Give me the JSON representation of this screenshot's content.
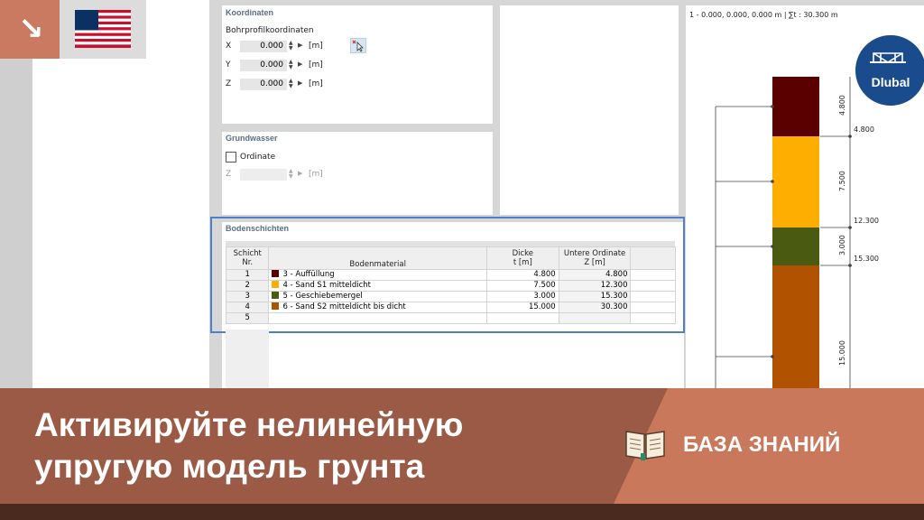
{
  "corner_arrow": "↘",
  "coords": {
    "title": "Koordinaten",
    "subtitle": "Bohrprofilkoordinaten",
    "rows": [
      {
        "label": "X",
        "value": "0.000",
        "unit": "[m]"
      },
      {
        "label": "Y",
        "value": "0.000",
        "unit": "[m]"
      },
      {
        "label": "Z",
        "value": "0.000",
        "unit": "[m]"
      }
    ]
  },
  "groundwater": {
    "title": "Grundwasser",
    "checkbox_label": "Ordinate",
    "z_label": "Z",
    "z_unit": "[m]"
  },
  "layers": {
    "title": "Bodenschichten",
    "headers": {
      "nr_line1": "Schicht",
      "nr_line2": "Nr.",
      "material": "Bodenmaterial",
      "thick_line1": "Dicke",
      "thick_line2": "t [m]",
      "ord_line1": "Untere Ordinate",
      "ord_line2": "Z [m]"
    },
    "rows": [
      {
        "nr": "1",
        "material": "3 - Auffüllung",
        "color": "#5a0000",
        "thickness": "4.800",
        "ordinate": "4.800"
      },
      {
        "nr": "2",
        "material": "4 - Sand S1 mitteldicht",
        "color": "#fdae00",
        "thickness": "7.500",
        "ordinate": "12.300"
      },
      {
        "nr": "3",
        "material": "5 - Geschiebemergel",
        "color": "#4a5a10",
        "thickness": "3.000",
        "ordinate": "15.300"
      },
      {
        "nr": "4",
        "material": "6 - Sand S2 mitteldicht bis dicht",
        "color": "#b05200",
        "thickness": "15.000",
        "ordinate": "30.300"
      },
      {
        "nr": "5",
        "material": "",
        "color": "",
        "thickness": "",
        "ordinate": ""
      }
    ]
  },
  "profile": {
    "header": "1 - 0.000, 0.000, 0.000 m | ∑t : 30.300 m",
    "thickness_labels": [
      "4.800",
      "7.500",
      "3.000",
      "15.000"
    ],
    "depth_labels": [
      "4.800",
      "12.300",
      "15.300"
    ]
  },
  "logo": {
    "text": "Dlubal"
  },
  "banner": {
    "headline_line1": "Активируйте нелинейную",
    "headline_line2": "упругую модель грунта",
    "kb_label": "БАЗА ЗНАНИЙ"
  }
}
